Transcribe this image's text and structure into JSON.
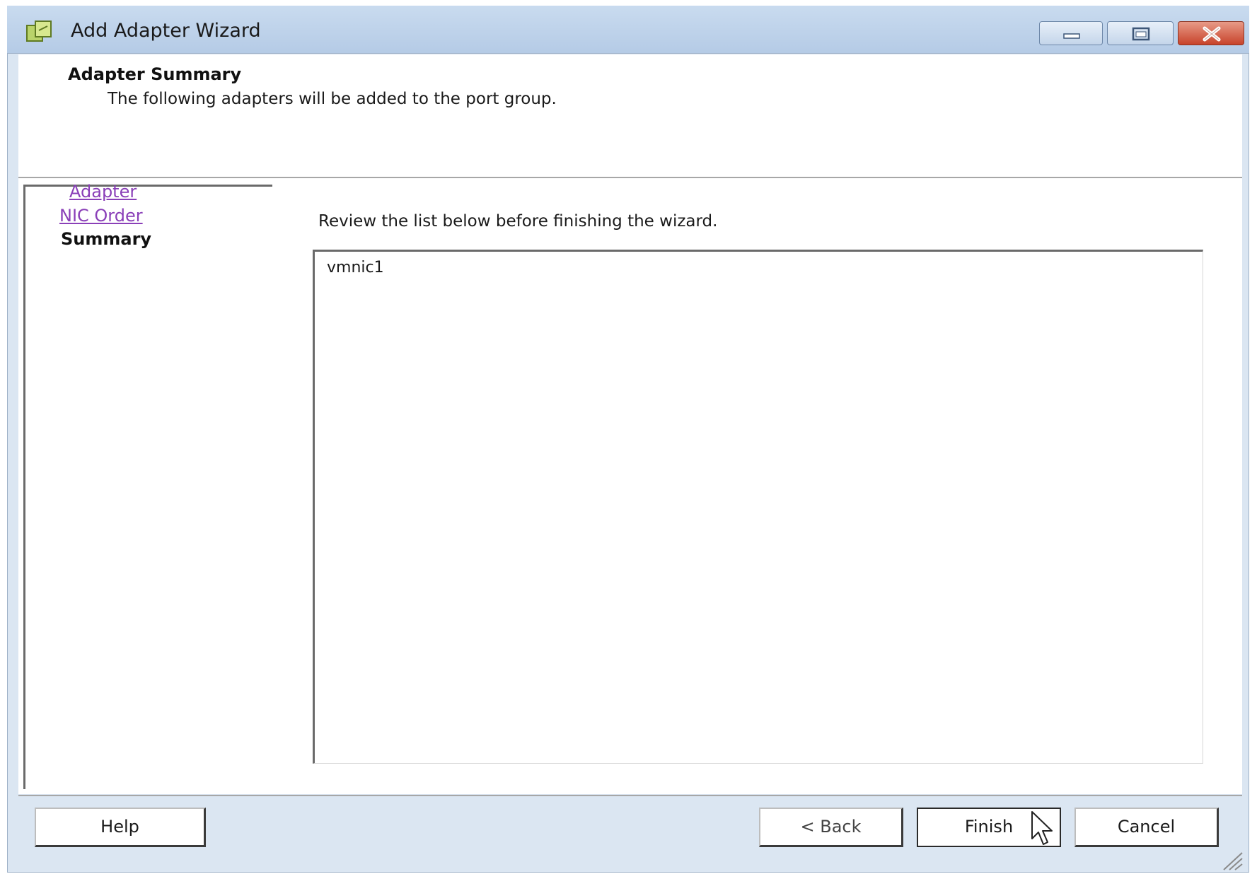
{
  "window": {
    "title": "Add Adapter Wizard",
    "icon": "wizard-app-icon"
  },
  "title_buttons": {
    "minimize_icon": "minimize-icon",
    "maximize_icon": "maximize-icon",
    "close_icon": "close-icon"
  },
  "header": {
    "title": "Adapter Summary",
    "subtitle": "The following adapters will be added to the port group."
  },
  "nav": {
    "items": [
      {
        "label": "Adapter",
        "state": "visited-link"
      },
      {
        "label": "NIC Order",
        "state": "visited-link"
      },
      {
        "label": "Summary",
        "state": "current"
      }
    ]
  },
  "main": {
    "instruction": "Review the list below before finishing the wizard.",
    "adapters": [
      "vmnic1"
    ]
  },
  "footer": {
    "help_label": "Help",
    "back_label": "< Back",
    "finish_label": "Finish",
    "cancel_label": "Cancel"
  },
  "colors": {
    "title_bar": "#b5cbe6",
    "visited_link": "#8a3fb8",
    "close_button": "#c8432b"
  }
}
